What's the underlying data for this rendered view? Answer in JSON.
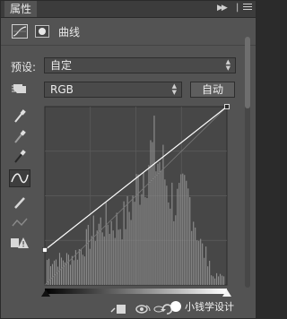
{
  "panel": {
    "tab_title": "属性",
    "header_label": "曲线"
  },
  "preset": {
    "label": "预设:",
    "value": "自定"
  },
  "channel": {
    "value": "RGB",
    "auto_label": "自动"
  },
  "watermark": {
    "text": "小钱学设计"
  },
  "colors": {
    "panel_bg": "#535353",
    "graph_bg": "#474747",
    "histogram": "#909090",
    "curve": "#ffffff"
  },
  "icons": [
    "curves-adjustment-icon",
    "layer-mask-icon",
    "on-image-adjust-hand-icon",
    "white-eyedropper-icon",
    "gray-eyedropper-icon",
    "black-eyedropper-icon",
    "curve-edit-icon",
    "pencil-icon",
    "smooth-curve-icon",
    "clipping-warning-icon"
  ],
  "curve": {
    "points": [
      [
        0,
        50
      ],
      [
        255,
        255
      ]
    ],
    "input_range": [
      0,
      255
    ],
    "output_range": [
      0,
      255
    ]
  }
}
